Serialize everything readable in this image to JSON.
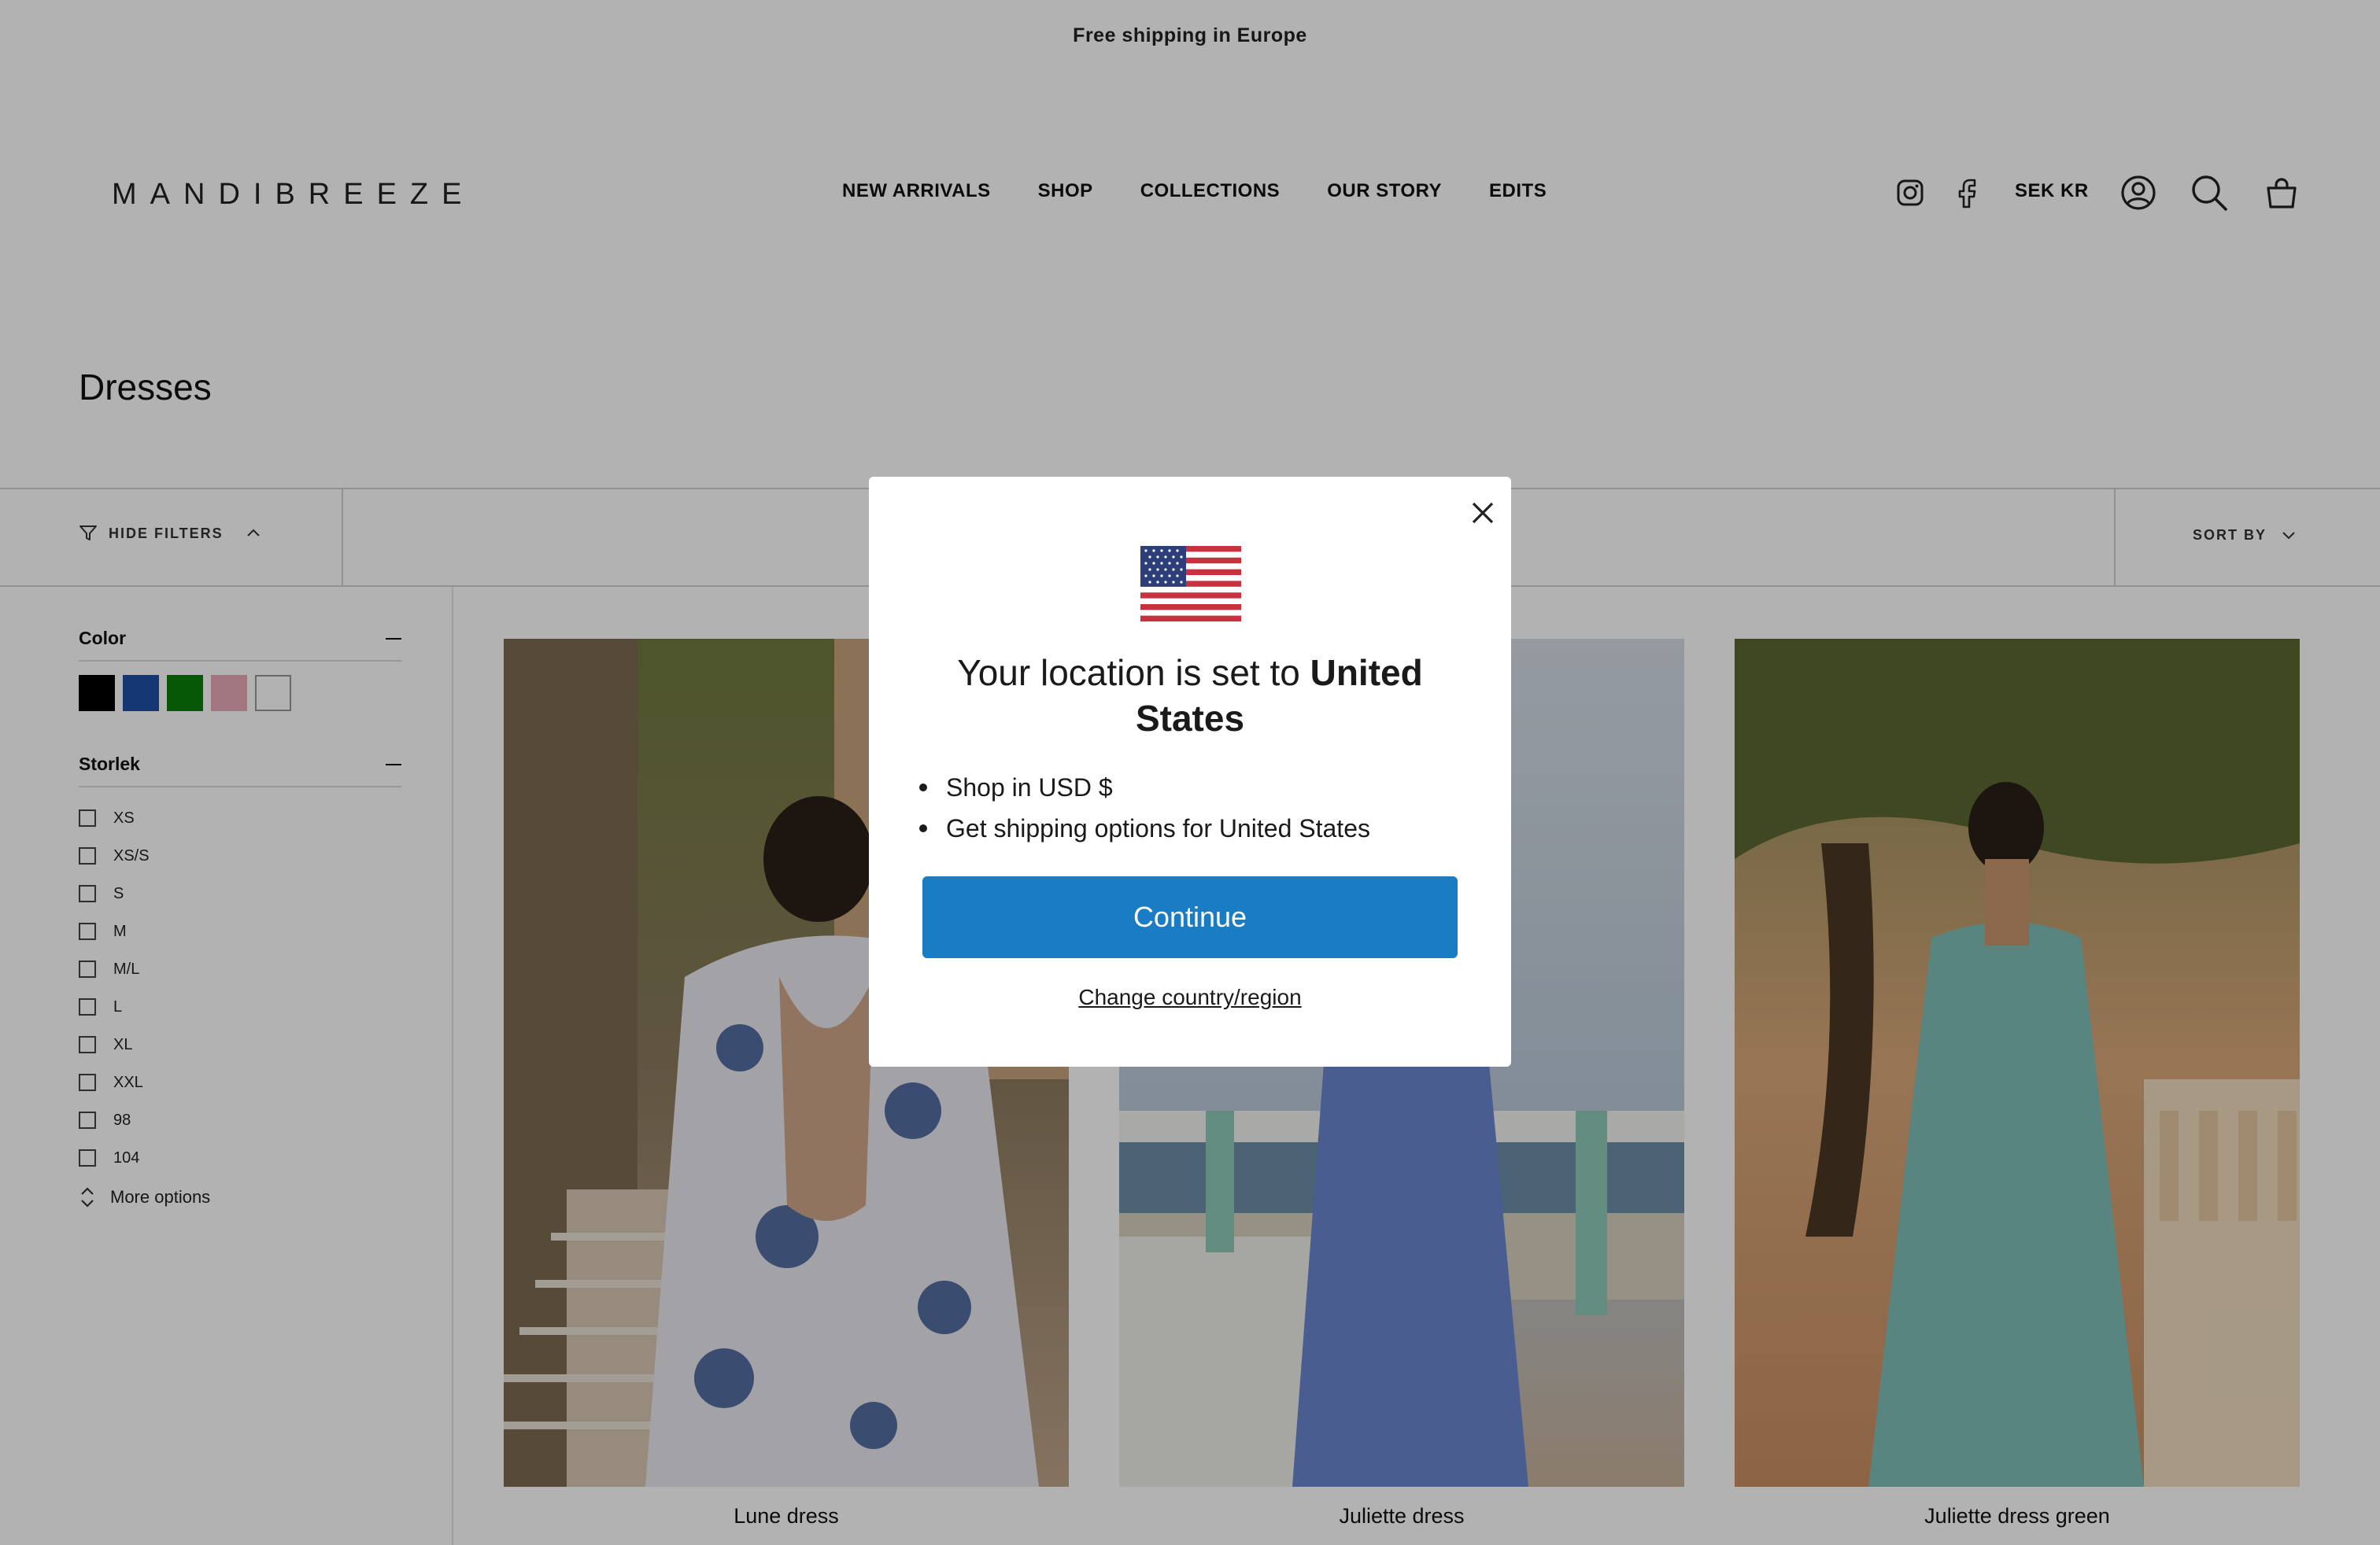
{
  "announcement": {
    "text": "Free shipping in Europe"
  },
  "header": {
    "logo": "MANDIBREEZE",
    "nav": [
      "NEW ARRIVALS",
      "SHOP",
      "COLLECTIONS",
      "OUR STORY",
      "EDITS"
    ],
    "currency": "SEK KR",
    "icons": [
      "instagram-icon",
      "facebook-icon",
      "account-icon",
      "search-icon",
      "cart-icon"
    ]
  },
  "page": {
    "title": "Dresses"
  },
  "filter_bar": {
    "hide_filters": "HIDE FILTERS",
    "sort_by": "SORT BY"
  },
  "filters": {
    "color": {
      "title": "Color",
      "swatches": [
        {
          "name": "black",
          "hex": "#000000"
        },
        {
          "name": "blue",
          "hex": "#1d4fa7"
        },
        {
          "name": "green",
          "hex": "#0a7d0a"
        },
        {
          "name": "pink",
          "hex": "#e7a9b7"
        },
        {
          "name": "white",
          "hex": "#ffffff"
        }
      ]
    },
    "size": {
      "title": "Storlek",
      "options": [
        "XS",
        "XS/S",
        "S",
        "M",
        "M/L",
        "L",
        "XL",
        "XXL",
        "98",
        "104"
      ],
      "more": "More options"
    }
  },
  "products": [
    {
      "name": "Lune dress"
    },
    {
      "name": "Juliette dress"
    },
    {
      "name": "Juliette dress green"
    }
  ],
  "modal": {
    "title_prefix": "Your location is set to ",
    "title_country": "United States",
    "bullets": [
      "Shop in USD $",
      "Get shipping options for United States"
    ],
    "continue": "Continue",
    "change": "Change country/region"
  },
  "colors": {
    "accent": "#1a7cc3",
    "overlay": "rgba(0,0,0,0.30)"
  }
}
